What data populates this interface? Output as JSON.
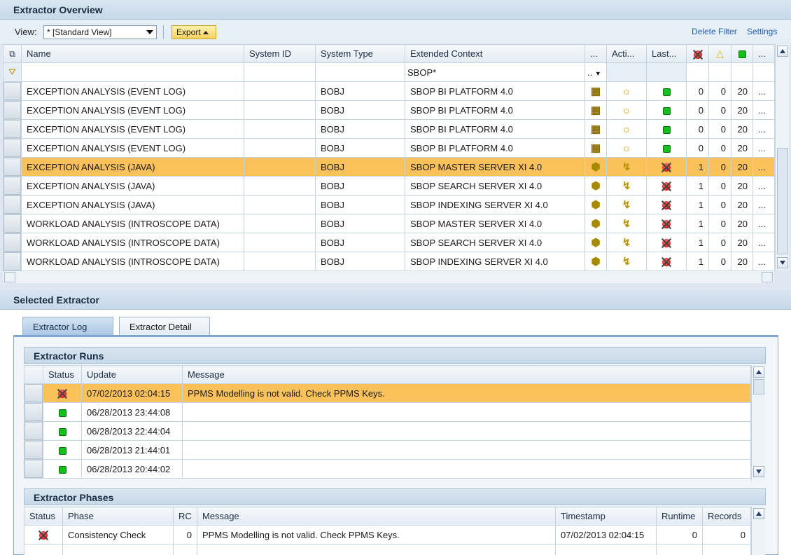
{
  "overview": {
    "title": "Extractor Overview",
    "view_label": "View:",
    "view_value": "* [Standard View]",
    "export_label": "Export",
    "delete_filter": "Delete Filter",
    "settings": "Settings",
    "columns": [
      "Name",
      "System ID",
      "System Type",
      "Extended Context",
      "...",
      "Acti...",
      "Last...",
      "",
      "",
      "",
      "..."
    ],
    "filter_context": "SBOP*",
    "filter_dots": "..",
    "rows": [
      {
        "name": "EXCEPTION ANALYSIS (EVENT LOG)",
        "sysid": "",
        "systype": "BOBJ",
        "context": "SBOP BI PLATFORM 4.0",
        "type_icon": "cube-icon",
        "active_icon": "lightbulb-icon",
        "last_status": "green",
        "red": "0",
        "yellow": "0",
        "green": "20",
        "more": "..."
      },
      {
        "name": "EXCEPTION ANALYSIS (EVENT LOG)",
        "sysid": "",
        "systype": "BOBJ",
        "context": "SBOP BI PLATFORM 4.0",
        "type_icon": "cube-icon",
        "active_icon": "lightbulb-icon",
        "last_status": "green",
        "red": "0",
        "yellow": "0",
        "green": "20",
        "more": "..."
      },
      {
        "name": "EXCEPTION ANALYSIS (EVENT LOG)",
        "sysid": "",
        "systype": "BOBJ",
        "context": "SBOP BI PLATFORM 4.0",
        "type_icon": "cube-icon",
        "active_icon": "lightbulb-icon",
        "last_status": "green",
        "red": "0",
        "yellow": "0",
        "green": "20",
        "more": "..."
      },
      {
        "name": "EXCEPTION ANALYSIS (EVENT LOG)",
        "sysid": "",
        "systype": "BOBJ",
        "context": "SBOP BI PLATFORM 4.0",
        "type_icon": "cube-icon",
        "active_icon": "lightbulb-icon",
        "last_status": "green",
        "red": "0",
        "yellow": "0",
        "green": "20",
        "more": "..."
      },
      {
        "name": "EXCEPTION ANALYSIS (JAVA)",
        "sysid": "",
        "systype": "BOBJ",
        "context": "SBOP MASTER SERVER XI 4.0",
        "type_icon": "server-icon",
        "active_icon": "bolt-icon",
        "last_status": "red",
        "red": "1",
        "yellow": "0",
        "green": "20",
        "more": "...",
        "highlight": true
      },
      {
        "name": "EXCEPTION ANALYSIS (JAVA)",
        "sysid": "",
        "systype": "BOBJ",
        "context": "SBOP SEARCH SERVER XI 4.0",
        "type_icon": "server-icon",
        "active_icon": "bolt-icon",
        "last_status": "red",
        "red": "1",
        "yellow": "0",
        "green": "20",
        "more": "..."
      },
      {
        "name": "EXCEPTION ANALYSIS (JAVA)",
        "sysid": "",
        "systype": "BOBJ",
        "context": "SBOP INDEXING SERVER XI 4.0",
        "type_icon": "server-icon",
        "active_icon": "bolt-icon",
        "last_status": "red",
        "red": "1",
        "yellow": "0",
        "green": "20",
        "more": "..."
      },
      {
        "name": "WORKLOAD ANALYSIS (INTROSCOPE DATA)",
        "sysid": "",
        "systype": "BOBJ",
        "context": "SBOP MASTER SERVER XI 4.0",
        "type_icon": "server-icon",
        "active_icon": "bolt-icon",
        "last_status": "red",
        "red": "1",
        "yellow": "0",
        "green": "20",
        "more": "..."
      },
      {
        "name": "WORKLOAD ANALYSIS (INTROSCOPE DATA)",
        "sysid": "",
        "systype": "BOBJ",
        "context": "SBOP SEARCH SERVER XI 4.0",
        "type_icon": "server-icon",
        "active_icon": "bolt-icon",
        "last_status": "red",
        "red": "1",
        "yellow": "0",
        "green": "20",
        "more": "..."
      },
      {
        "name": "WORKLOAD ANALYSIS (INTROSCOPE DATA)",
        "sysid": "",
        "systype": "BOBJ",
        "context": "SBOP INDEXING SERVER XI 4.0",
        "type_icon": "server-icon",
        "active_icon": "bolt-icon",
        "last_status": "red",
        "red": "1",
        "yellow": "0",
        "green": "20",
        "more": "..."
      }
    ]
  },
  "selected": {
    "title": "Selected Extractor",
    "tabs": [
      "Extractor Log",
      "Extractor Detail"
    ],
    "runs": {
      "title": "Extractor Runs",
      "columns": [
        "Status",
        "Update",
        "Message"
      ],
      "rows": [
        {
          "status": "red",
          "update": "07/02/2013 02:04:15",
          "message": "PPMS Modelling is not valid. Check PPMS Keys.",
          "highlight": true
        },
        {
          "status": "green",
          "update": "06/28/2013 23:44:08",
          "message": ""
        },
        {
          "status": "green",
          "update": "06/28/2013 22:44:04",
          "message": ""
        },
        {
          "status": "green",
          "update": "06/28/2013 21:44:01",
          "message": ""
        },
        {
          "status": "green",
          "update": "06/28/2013 20:44:02",
          "message": ""
        }
      ]
    },
    "phases": {
      "title": "Extractor Phases",
      "columns": [
        "Status",
        "Phase",
        "RC",
        "Message",
        "Timestamp",
        "Runtime",
        "Records"
      ],
      "rows": [
        {
          "status": "red",
          "phase": "Consistency Check",
          "rc": "0",
          "message": "PPMS Modelling is not valid. Check PPMS Keys.",
          "timestamp": "07/02/2013 02:04:15",
          "runtime": "0",
          "records": "0"
        }
      ]
    }
  }
}
